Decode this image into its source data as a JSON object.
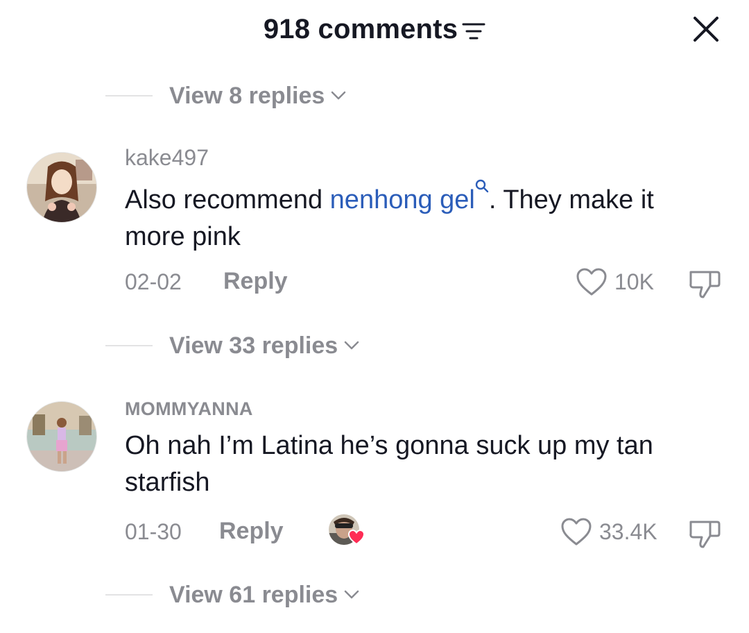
{
  "header": {
    "comment_count": "918 comments",
    "sort_icon": "filter-icon",
    "close_icon": "close-icon"
  },
  "thread": {
    "top_replies_label": "View 8 replies",
    "comments": [
      {
        "username": "kake497",
        "text_before": "Also recommend ",
        "link_text": "nenhong gel",
        "text_after": ". They make it more pink",
        "date": "02-02",
        "reply_label": "Reply",
        "likes": "10K",
        "replies_label": "View 33 replies"
      },
      {
        "username": "MOMMYANNA",
        "text": "Oh nah I’m Latina he’s gonna suck up my tan starfish",
        "date": "01-30",
        "reply_label": "Reply",
        "likes": "33.4K",
        "creator_liked": true,
        "replies_label": "View 61 replies"
      }
    ]
  },
  "colors": {
    "text_primary": "#161823",
    "text_secondary": "#8a8b91",
    "link": "#2b5db9",
    "creator_heart": "#fe2c55"
  }
}
